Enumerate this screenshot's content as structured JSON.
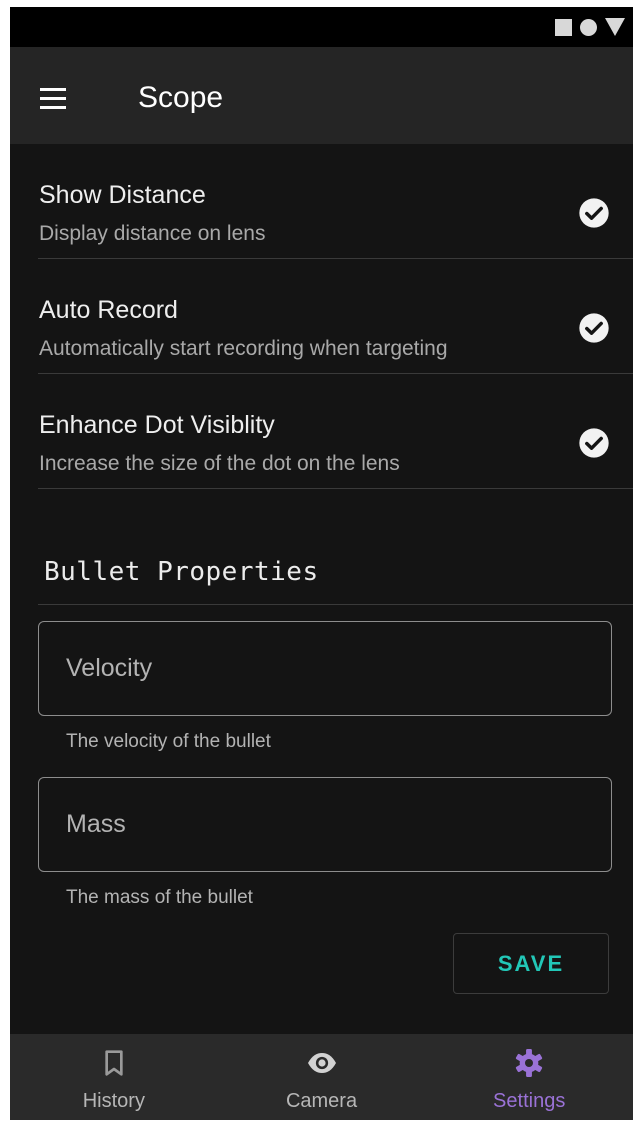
{
  "app_bar": {
    "title": "Scope",
    "menu_icon": "hamburger-menu-icon"
  },
  "status_bar": {
    "icons": [
      "square-icon",
      "circle-icon",
      "triangle-icon"
    ]
  },
  "settings": [
    {
      "title": "Show Distance",
      "subtitle": "Display distance on lens",
      "checked": true
    },
    {
      "title": "Auto Record",
      "subtitle": "Automatically start recording when targeting",
      "checked": true
    },
    {
      "title": "Enhance Dot Visiblity",
      "subtitle": "Increase the size of the dot on the lens",
      "checked": true
    }
  ],
  "bullet_properties": {
    "header": "Bullet Properties",
    "velocity": {
      "value": "",
      "placeholder": "Velocity",
      "helper": "The velocity of the bullet"
    },
    "mass": {
      "value": "",
      "placeholder": "Mass",
      "helper": "The mass of the bullet"
    },
    "save_label": "SAVE"
  },
  "bottom_nav": {
    "items": [
      {
        "label": "History",
        "icon": "bookmark-icon",
        "active": false
      },
      {
        "label": "Camera",
        "icon": "eye-icon",
        "active": false
      },
      {
        "label": "Settings",
        "icon": "gear-icon",
        "active": true
      }
    ]
  },
  "colors": {
    "background": "#141414",
    "app_bar": "#252525",
    "bottom_nav": "#2a2a2a",
    "accent_teal": "#22c7b7",
    "active_purple": "#9a72d6"
  }
}
